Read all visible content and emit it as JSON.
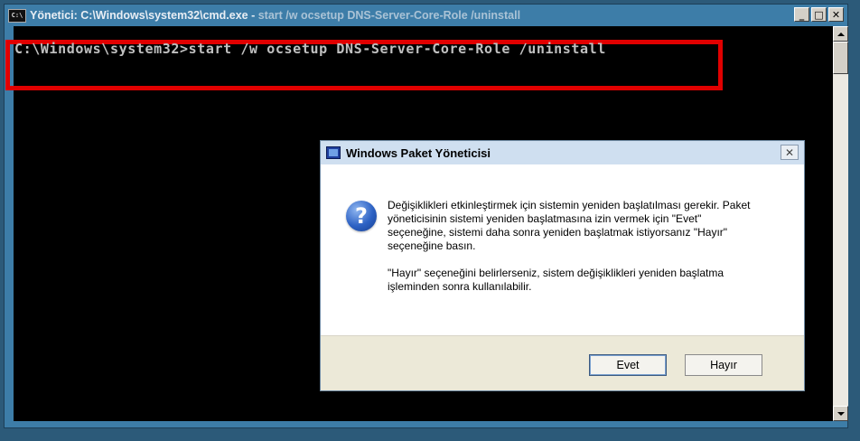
{
  "window": {
    "title_prefix": "Yönetici: C:\\Windows\\system32\\cmd.exe - ",
    "title_command": "start  /w ocsetup DNS-Server-Core-Role /uninstall",
    "icon_label": "C:\\"
  },
  "console": {
    "command_line": "C:\\Windows\\system32>start /w ocsetup DNS-Server-Core-Role /uninstall"
  },
  "dialog": {
    "title": "Windows Paket Yöneticisi",
    "close_symbol": "✕",
    "icon_symbol": "?",
    "message_line1": "Değişiklikleri etkinleştirmek için sistemin yeniden başlatılması gerekir. Paket yöneticisinin sistemi yeniden başlatmasına izin vermek için \"Evet\" seçeneğine, sistemi daha sonra yeniden başlatmak istiyorsanız \"Hayır\" seçeneğine basın.",
    "message_line2": "\"Hayır\" seçeneğini belirlerseniz, sistem değişiklikleri yeniden başlatma işleminden sonra kullanılabilir.",
    "yes_label": "Evet",
    "no_label": "Hayır"
  },
  "controls": {
    "minimize": "_",
    "maximize": "□",
    "close": "✕"
  },
  "colors": {
    "highlight": "#e00000",
    "console_bg": "#000000",
    "console_text": "#c0c0c0"
  }
}
